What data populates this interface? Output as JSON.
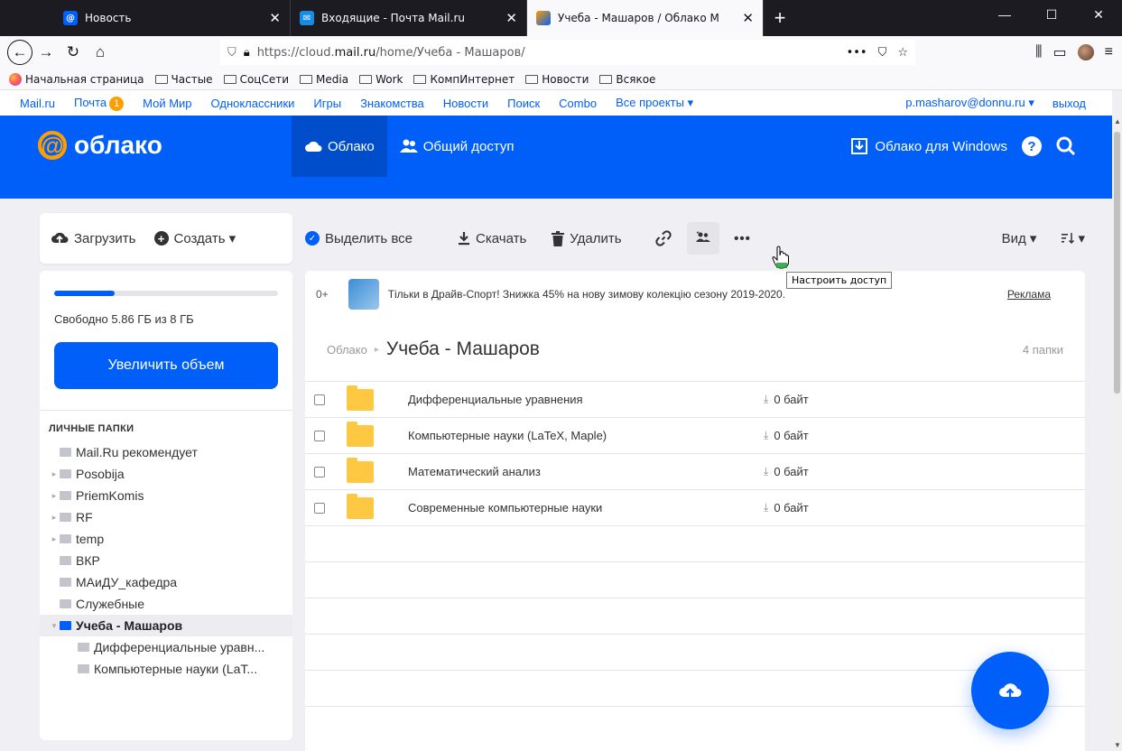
{
  "browser": {
    "tabs": [
      {
        "title": "Новость",
        "active": false
      },
      {
        "title": "Входящие - Почта Mail.ru",
        "active": false
      },
      {
        "title": "Учеба - Машаров / Облако М",
        "active": true
      }
    ],
    "url_prefix": "https://cloud.",
    "url_host": "mail.ru",
    "url_path": "/home/Учеба - Машаров/",
    "bookmarks": [
      "Начальная страница",
      "Частые",
      "СоцСети",
      "Media",
      "Work",
      "КомпИнтернет",
      "Новости",
      "Всякое"
    ]
  },
  "portal": {
    "links": [
      "Mail.ru",
      "Почта",
      "Мой Мир",
      "Одноклассники",
      "Игры",
      "Знакомства",
      "Новости",
      "Поиск",
      "Combo",
      "Все проекты ▾"
    ],
    "mail_badge": "1",
    "user": "p.masharov@donnu.ru ▾",
    "logout": "выход"
  },
  "header": {
    "logo_word": "облако",
    "nav": [
      {
        "label": "Облако",
        "active": true
      },
      {
        "label": "Общий доступ",
        "active": false
      }
    ],
    "windows_label": "Облако для Windows",
    "help_label": "?"
  },
  "sidebar": {
    "upload_label": "Загрузить",
    "create_label": "Создать ▾",
    "storage_used_fraction": 0.27,
    "free_text": "Свободно 5.86 ГБ из 8 ГБ",
    "increase_label": "Увеличить объем",
    "section_title": "ЛИЧНЫЕ ПАПКИ",
    "tree": [
      {
        "label": "Mail.Ru рекомендует",
        "level": 1,
        "arrow": false,
        "active": false
      },
      {
        "label": "Posobija",
        "level": 1,
        "arrow": true,
        "active": false
      },
      {
        "label": "PriemKomis",
        "level": 1,
        "arrow": true,
        "active": false
      },
      {
        "label": "RF",
        "level": 1,
        "arrow": true,
        "active": false
      },
      {
        "label": "temp",
        "level": 1,
        "arrow": true,
        "active": false
      },
      {
        "label": "ВКР",
        "level": 1,
        "arrow": false,
        "active": false
      },
      {
        "label": "МАиДУ_кафедра",
        "level": 1,
        "arrow": false,
        "active": false
      },
      {
        "label": "Служебные",
        "level": 1,
        "arrow": false,
        "active": false
      },
      {
        "label": "Учеба - Машаров",
        "level": 1,
        "arrow": true,
        "active": true
      },
      {
        "label": "Дифференциальные уравн...",
        "level": 2,
        "arrow": false,
        "active": false
      },
      {
        "label": "Компьютерные науки (LaT...",
        "level": 2,
        "arrow": false,
        "active": false
      }
    ]
  },
  "toolbar": {
    "select_all": "Выделить все",
    "download": "Скачать",
    "delete": "Удалить",
    "view": "Вид ▾",
    "tooltip": "Настроить доступ"
  },
  "ad": {
    "age": "0+",
    "text": "Тільки в Драйв-Спорт!   Знижка 45% на нову зимову колекцію сезону 2019-2020.",
    "label": "Реклама"
  },
  "breadcrumb": {
    "root": "Облако",
    "current": "Учеба - Машаров",
    "count": "4 папки"
  },
  "files": [
    {
      "name": "Дифференциальные уравнения",
      "size": "0 байт"
    },
    {
      "name": "Компьютерные науки (LaTeX, Maple)",
      "size": "0 байт"
    },
    {
      "name": "Математический анализ",
      "size": "0 байт"
    },
    {
      "name": "Современные компьютерные науки",
      "size": "0 байт"
    }
  ],
  "colors": {
    "brand": "#005ff9",
    "accent": "#ff9e00",
    "folder": "#ffc843"
  }
}
